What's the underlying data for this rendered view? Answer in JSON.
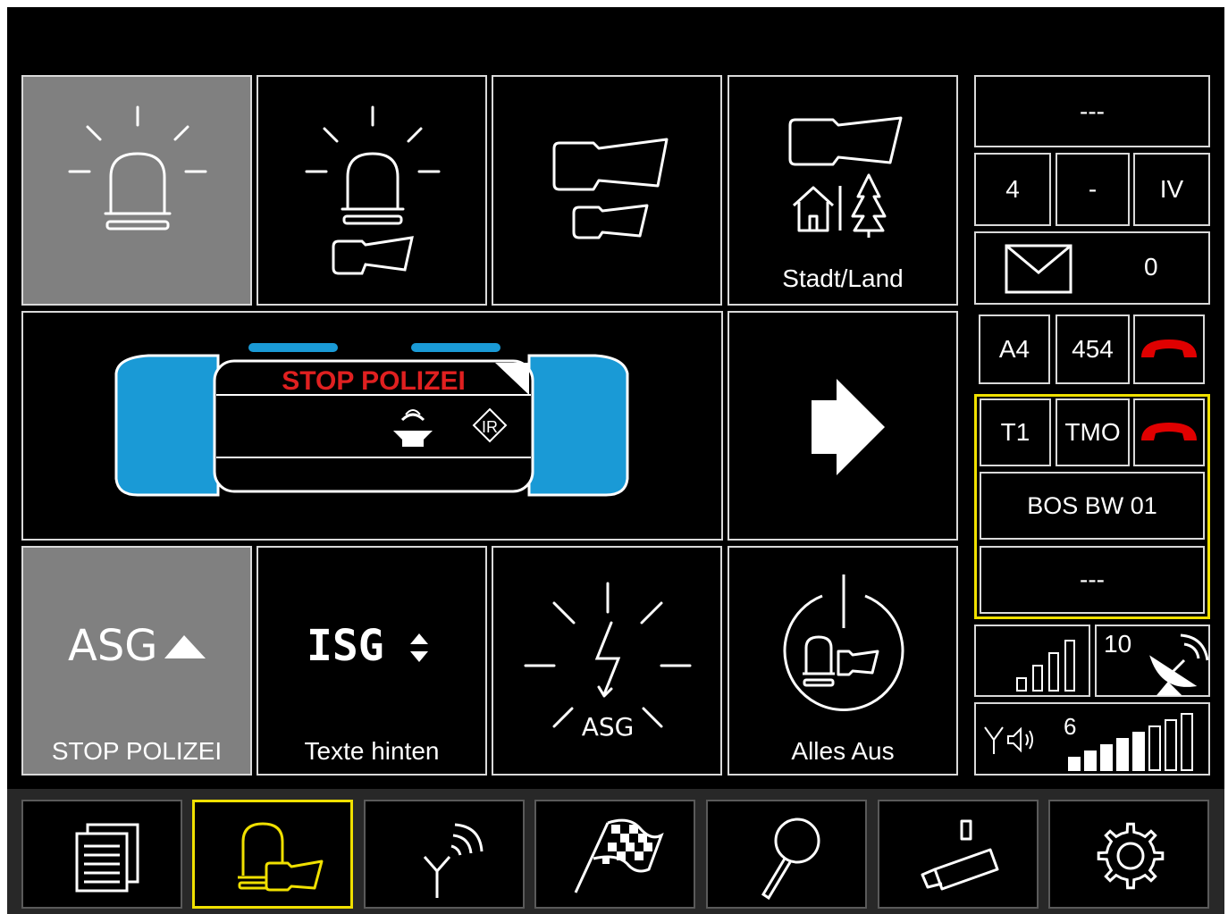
{
  "main": {
    "stadt_land_label": "Stadt/Land",
    "stop_polizei_label": "STOP POLIZEI",
    "texte_hinten_label": "Texte hinten",
    "alles_aus_label": "Alles Aus",
    "asg_label": "ASG",
    "isg_label": "ISG",
    "flash_asg_label": "ASG",
    "lightbar_text": "STOP POLIZEI",
    "lightbar_ir_label": "IR"
  },
  "status": {
    "top_value": "---",
    "group_a": "4",
    "group_sep": "-",
    "group_b": "IV",
    "message_count": "0",
    "call1_left": "A4",
    "call1_right": "454",
    "call2_left": "T1",
    "call2_right": "TMO",
    "network_name": "BOS BW 01",
    "network_sub": "---",
    "gps_count": "10",
    "volume_value": "6",
    "signal_bars_level": 4,
    "signal_bars_total": 4,
    "volume_level": 5,
    "volume_total": 8
  },
  "colors": {
    "active_tile": "#808080",
    "lightbar_blue": "#1a9ad6",
    "lightbar_text": "#e02020",
    "hangup_red": "#e00000",
    "highlight_yellow": "#f0e000"
  },
  "nav": {
    "items": [
      "documents-icon",
      "light-siren-icon",
      "antenna-icon",
      "checkered-flag-icon",
      "search-icon",
      "camera-icon",
      "settings-icon"
    ],
    "selected": "light-siren-icon"
  }
}
